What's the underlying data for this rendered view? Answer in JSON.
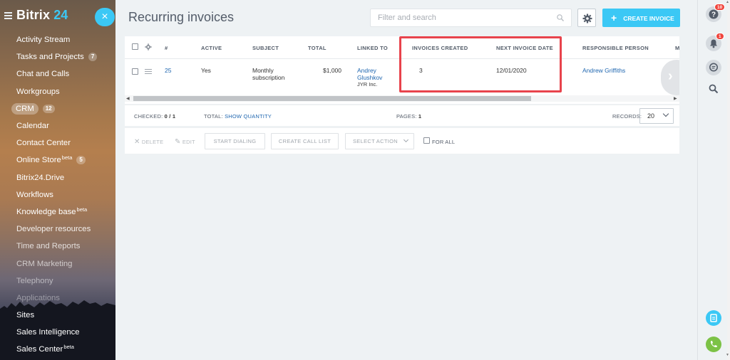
{
  "sidebar": {
    "logo_text": "Bitrix",
    "logo_number": "24",
    "items": [
      {
        "label": "Activity Stream",
        "counter": "",
        "sup": ""
      },
      {
        "label": "Tasks and Projects",
        "counter": "7",
        "sup": ""
      },
      {
        "label": "Chat and Calls",
        "counter": "",
        "sup": ""
      },
      {
        "label": "Workgroups",
        "counter": "",
        "sup": ""
      },
      {
        "label": "CRM",
        "counter": "12",
        "sup": "",
        "active": true
      },
      {
        "label": "Calendar",
        "counter": "",
        "sup": ""
      },
      {
        "label": "Contact Center",
        "counter": "",
        "sup": ""
      },
      {
        "label": "Online Store",
        "counter": "5",
        "sup": "beta"
      },
      {
        "label": "Bitrix24.Drive",
        "counter": "",
        "sup": ""
      },
      {
        "label": "Workflows",
        "counter": "",
        "sup": ""
      },
      {
        "label": "Knowledge base",
        "counter": "",
        "sup": "beta"
      },
      {
        "label": "Developer resources",
        "counter": "",
        "sup": ""
      },
      {
        "label": "Time and Reports",
        "counter": "",
        "sup": ""
      },
      {
        "label": "CRM Marketing",
        "counter": "",
        "sup": ""
      },
      {
        "label": "Telephony",
        "counter": "",
        "sup": ""
      },
      {
        "label": "Applications",
        "counter": "",
        "sup": ""
      },
      {
        "label": "Sites",
        "counter": "",
        "sup": ""
      },
      {
        "label": "Sales Intelligence",
        "counter": "",
        "sup": ""
      },
      {
        "label": "Sales Center",
        "counter": "",
        "sup": "beta"
      }
    ],
    "close_glyph": "×"
  },
  "header": {
    "title": "Recurring invoices",
    "search_placeholder": "Filter and search",
    "create_label": "CREATE INVOICE",
    "create_glyph": "+"
  },
  "grid": {
    "columns": {
      "id": "#",
      "active": "ACTIVE",
      "subject": "SUBJECT",
      "total": "TOTAL",
      "linked_to": "LINKED TO",
      "invoices_created": "INVOICES CREATED",
      "next_invoice_date": "NEXT INVOICE DATE",
      "responsible": "RESPONSIBLE PERSON",
      "more": "M"
    },
    "row": {
      "id": "25",
      "active": "Yes",
      "subject_line1": "Monthly",
      "subject_line2": "subscription",
      "total": "$1,000",
      "linked_name_line1": "Andrey",
      "linked_name_line2": "Glushkov",
      "linked_company": "JYR Inc.",
      "invoices_created": "3",
      "next_invoice_date": "12/01/2020",
      "responsible": "Andrew Griffiths"
    }
  },
  "footer": {
    "checked_label": "CHECKED:",
    "checked_value": "0 / 1",
    "total_label": "TOTAL:",
    "show_quantity": "SHOW QUANTITY",
    "pages_label": "PAGES:",
    "pages_value": "1",
    "records_label": "RECORDS:",
    "records_value": "20"
  },
  "actions": {
    "delete": "DELETE",
    "edit": "EDIT",
    "start_dialing": "START DIALING",
    "create_call_list": "CREATE CALL LIST",
    "select_action": "SELECT ACTION",
    "for_all": "FOR ALL"
  },
  "right_bar": {
    "help_badge": "10",
    "notifications_badge": "1"
  },
  "colors": {
    "accent": "#3bc8f5",
    "link": "#2067b0",
    "highlight": "#e8434c",
    "call": "#7cc246"
  }
}
